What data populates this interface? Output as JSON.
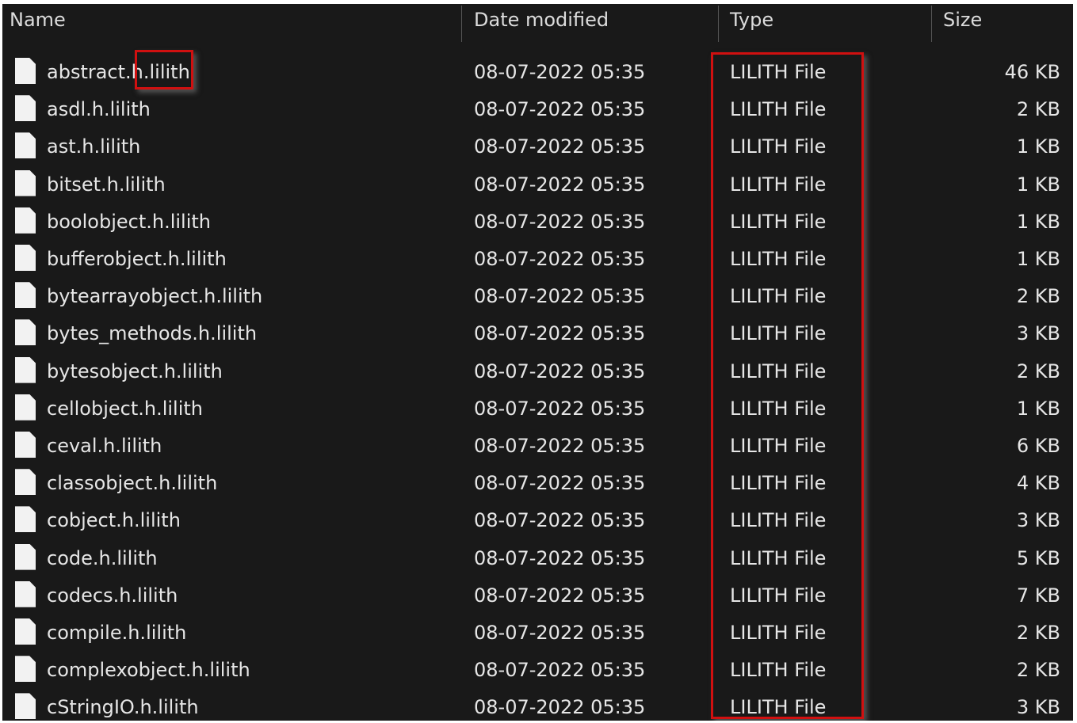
{
  "columns": {
    "name": "Name",
    "date": "Date modified",
    "type": "Type",
    "size": "Size"
  },
  "highlight_color": "#d01010",
  "files": [
    {
      "name": "abstract.h.lilith",
      "date": "08-07-2022 05:35",
      "type": "LILITH File",
      "size": "46 KB"
    },
    {
      "name": "asdl.h.lilith",
      "date": "08-07-2022 05:35",
      "type": "LILITH File",
      "size": "2 KB"
    },
    {
      "name": "ast.h.lilith",
      "date": "08-07-2022 05:35",
      "type": "LILITH File",
      "size": "1 KB"
    },
    {
      "name": "bitset.h.lilith",
      "date": "08-07-2022 05:35",
      "type": "LILITH File",
      "size": "1 KB"
    },
    {
      "name": "boolobject.h.lilith",
      "date": "08-07-2022 05:35",
      "type": "LILITH File",
      "size": "1 KB"
    },
    {
      "name": "bufferobject.h.lilith",
      "date": "08-07-2022 05:35",
      "type": "LILITH File",
      "size": "1 KB"
    },
    {
      "name": "bytearrayobject.h.lilith",
      "date": "08-07-2022 05:35",
      "type": "LILITH File",
      "size": "2 KB"
    },
    {
      "name": "bytes_methods.h.lilith",
      "date": "08-07-2022 05:35",
      "type": "LILITH File",
      "size": "3 KB"
    },
    {
      "name": "bytesobject.h.lilith",
      "date": "08-07-2022 05:35",
      "type": "LILITH File",
      "size": "2 KB"
    },
    {
      "name": "cellobject.h.lilith",
      "date": "08-07-2022 05:35",
      "type": "LILITH File",
      "size": "1 KB"
    },
    {
      "name": "ceval.h.lilith",
      "date": "08-07-2022 05:35",
      "type": "LILITH File",
      "size": "6 KB"
    },
    {
      "name": "classobject.h.lilith",
      "date": "08-07-2022 05:35",
      "type": "LILITH File",
      "size": "4 KB"
    },
    {
      "name": "cobject.h.lilith",
      "date": "08-07-2022 05:35",
      "type": "LILITH File",
      "size": "3 KB"
    },
    {
      "name": "code.h.lilith",
      "date": "08-07-2022 05:35",
      "type": "LILITH File",
      "size": "5 KB"
    },
    {
      "name": "codecs.h.lilith",
      "date": "08-07-2022 05:35",
      "type": "LILITH File",
      "size": "7 KB"
    },
    {
      "name": "compile.h.lilith",
      "date": "08-07-2022 05:35",
      "type": "LILITH File",
      "size": "2 KB"
    },
    {
      "name": "complexobject.h.lilith",
      "date": "08-07-2022 05:35",
      "type": "LILITH File",
      "size": "2 KB"
    },
    {
      "name": "cStringIO.h.lilith",
      "date": "08-07-2022 05:35",
      "type": "LILITH File",
      "size": "3 KB"
    }
  ]
}
